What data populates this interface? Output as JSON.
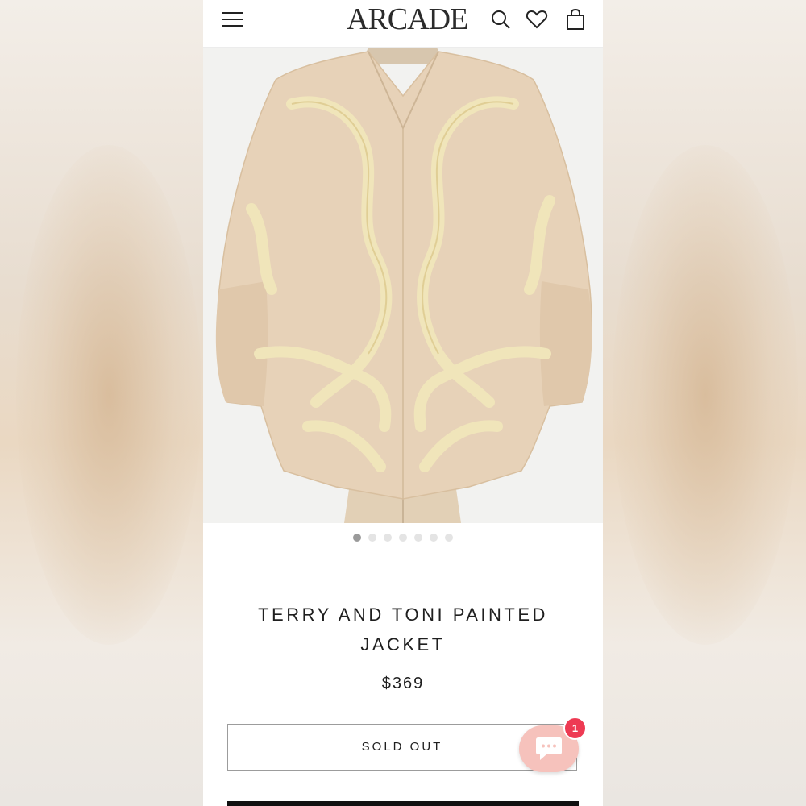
{
  "header": {
    "logo": "ARCADE",
    "icons": [
      "menu-icon",
      "search-icon",
      "heart-icon",
      "cart-icon"
    ]
  },
  "product": {
    "image_alt": "beige jacket with painted gold ribbon on dress form",
    "gallery": {
      "count": 7,
      "active_index": 0
    },
    "title": "TERRY AND TONI PAINTED JACKET",
    "price": "$369",
    "button_label": "SOLD OUT"
  },
  "chat": {
    "icon": "chat-bubble-icon",
    "badge_count": "1"
  },
  "colors": {
    "jacket": "#e6cfb4",
    "ribbon": "#f0e6b6",
    "badge": "#ee3a53",
    "chat_bg": "#f6c2bc"
  }
}
